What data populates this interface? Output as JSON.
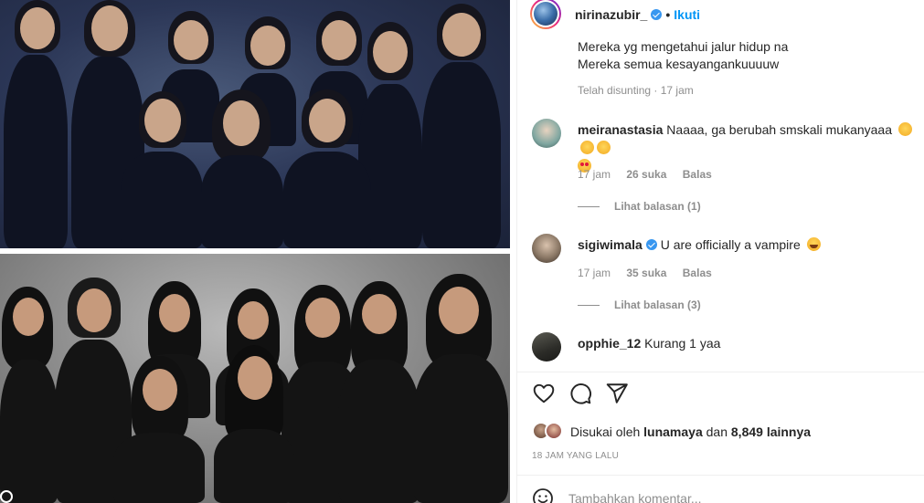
{
  "header": {
    "username": "nirinazubir_",
    "separator": "•",
    "follow_label": "Ikuti"
  },
  "caption": {
    "lines": [
      "Mereka yg mengetahui jalur hidup na",
      "Mereka semua kesayangankuuuuw"
    ],
    "edited": "Telah disunting",
    "time": "17 jam"
  },
  "comments": [
    {
      "username": "meiranastasia",
      "text": "Naaaa, ga berubah smskali mukanyaaa",
      "time": "17 jam",
      "likes": "26 suka",
      "reply": "Balas",
      "view_replies": "Lihat balasan (1)",
      "emoji": [
        "clapping-hands",
        "clapping-hands",
        "clapping-hands",
        "smiling-face-with-heart-eyes"
      ]
    },
    {
      "username": "sigiwimala",
      "text": "U are officially a vampire",
      "time": "17 jam",
      "likes": "35 suka",
      "reply": "Balas",
      "view_replies": "Lihat balasan (3)",
      "emoji": [
        "face-with-tears-of-joy"
      ]
    },
    {
      "username": "opphie_12",
      "text": "Kurang 1 yaa"
    }
  ],
  "likes": {
    "prefix": "Disukai oleh",
    "user": "lunamaya",
    "conj": "dan",
    "count": "8,849 lainnya"
  },
  "timestamp": "18 JAM YANG LALU",
  "comment_box": {
    "placeholder": "Tambahkan komentar..."
  },
  "colors": {
    "accent": "#0095f6",
    "verified": "#3897f0",
    "muted": "#8e8e8e",
    "text": "#262626"
  },
  "icons": [
    "verified-badge-icon",
    "heart-icon",
    "comment-icon",
    "share-icon",
    "emoji-icon"
  ]
}
